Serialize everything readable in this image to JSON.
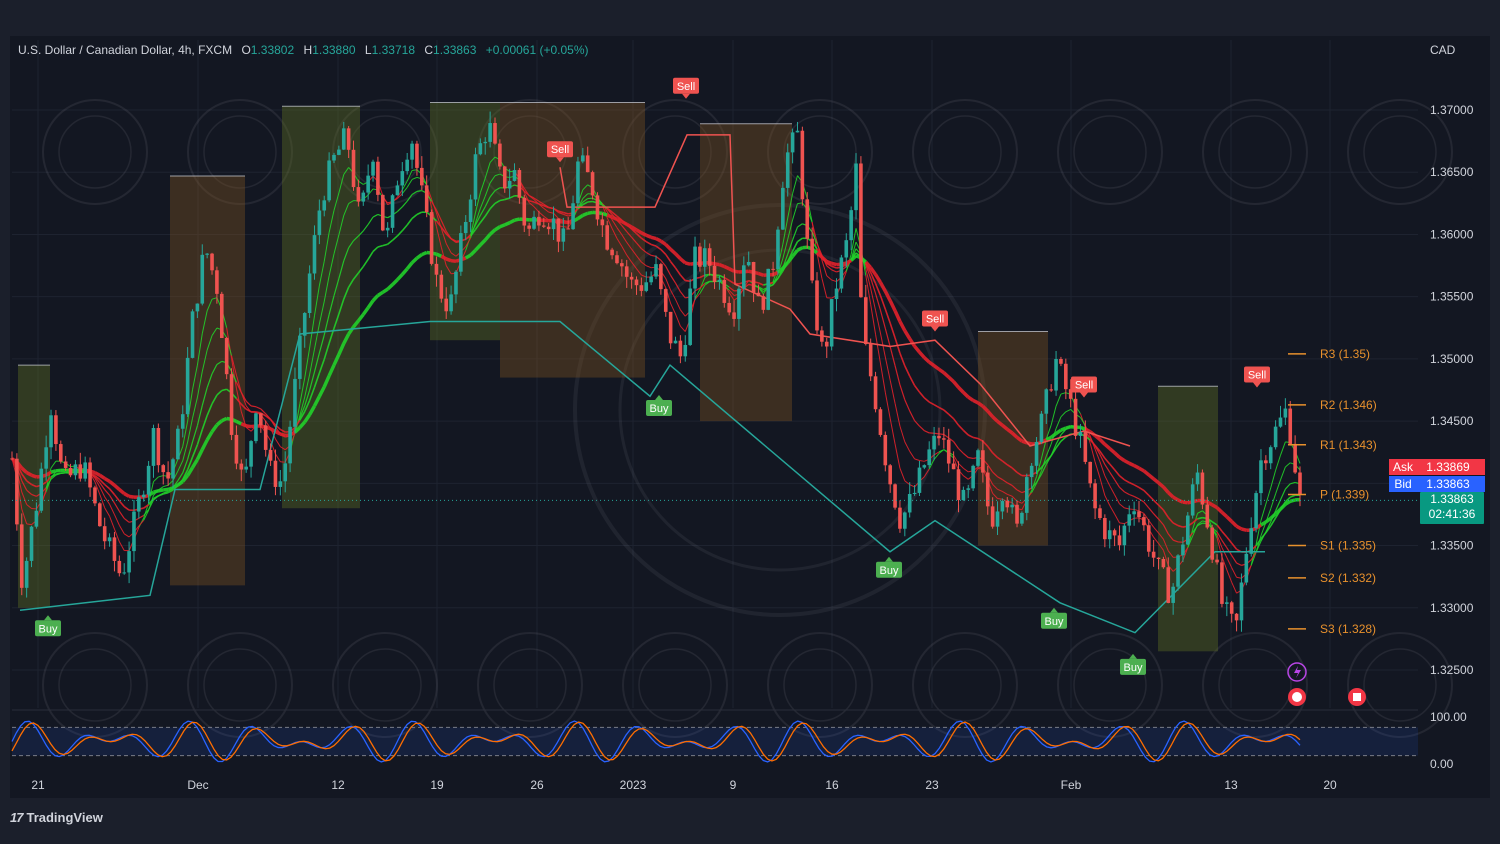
{
  "header": {
    "symbol": "U.S. Dollar / Canadian Dollar, 4h, FXCM",
    "open_label": "O",
    "open": "1.33802",
    "high_label": "H",
    "high": "1.33880",
    "low_label": "L",
    "low": "1.33718",
    "close_label": "C",
    "close": "1.33863",
    "change": "+0.00061 (+0.05%)"
  },
  "currency": "CAD",
  "quote": {
    "ask_label": "Ask",
    "ask": "1.33869",
    "bid_label": "Bid",
    "bid": "1.33863",
    "last_price": "1.33863",
    "countdown": "02:41:36"
  },
  "brand": {
    "name": "TradingView"
  },
  "colors": {
    "background": "#131722",
    "bull": "#26a69a",
    "bear": "#ef5350",
    "ema_green": "#22d12a",
    "ema_red": "#e3222b",
    "pivot": "#e8912d",
    "ask": "#f23645",
    "bid": "#2962ff"
  },
  "chart_data": {
    "type": "candlestick",
    "timeframe": "4h",
    "ylim": [
      1.322,
      1.3745
    ],
    "y_ticks": [
      "1.37000",
      "1.36500",
      "1.36000",
      "1.35500",
      "1.35000",
      "1.34500",
      "1.34000",
      "1.33500",
      "1.33000",
      "1.32500"
    ],
    "x_ticks": [
      "21",
      "Dec",
      "12",
      "19",
      "26",
      "2023",
      "9",
      "16",
      "23",
      "Feb",
      "13",
      "20"
    ],
    "close_path": [
      [
        0,
        1.342
      ],
      [
        0.008,
        1.332
      ],
      [
        0.02,
        1.339
      ],
      [
        0.03,
        1.3465
      ],
      [
        0.04,
        1.34
      ],
      [
        0.055,
        1.3415
      ],
      [
        0.07,
        1.336
      ],
      [
        0.085,
        1.3325
      ],
      [
        0.1,
        1.339
      ],
      [
        0.11,
        1.344
      ],
      [
        0.12,
        1.34
      ],
      [
        0.13,
        1.344
      ],
      [
        0.14,
        1.353
      ],
      [
        0.15,
        1.359
      ],
      [
        0.16,
        1.3555
      ],
      [
        0.17,
        1.345
      ],
      [
        0.18,
        1.3395
      ],
      [
        0.19,
        1.347
      ],
      [
        0.2,
        1.341
      ],
      [
        0.21,
        1.34
      ],
      [
        0.22,
        1.348
      ],
      [
        0.23,
        1.356
      ],
      [
        0.24,
        1.363
      ],
      [
        0.25,
        1.366
      ],
      [
        0.26,
        1.368
      ],
      [
        0.27,
        1.361
      ],
      [
        0.28,
        1.367
      ],
      [
        0.29,
        1.359
      ],
      [
        0.3,
        1.365
      ],
      [
        0.31,
        1.368
      ],
      [
        0.32,
        1.362
      ],
      [
        0.33,
        1.356
      ],
      [
        0.34,
        1.354
      ],
      [
        0.35,
        1.36
      ],
      [
        0.36,
        1.366
      ],
      [
        0.37,
        1.369
      ],
      [
        0.38,
        1.364
      ],
      [
        0.39,
        1.365
      ],
      [
        0.4,
        1.36
      ],
      [
        0.41,
        1.362
      ],
      [
        0.42,
        1.361
      ],
      [
        0.43,
        1.359
      ],
      [
        0.44,
        1.366
      ],
      [
        0.45,
        1.364
      ],
      [
        0.46,
        1.36
      ],
      [
        0.47,
        1.3585
      ],
      [
        0.48,
        1.356
      ],
      [
        0.49,
        1.356
      ],
      [
        0.5,
        1.357
      ],
      [
        0.51,
        1.352
      ],
      [
        0.52,
        1.35
      ],
      [
        0.53,
        1.358
      ],
      [
        0.54,
        1.358
      ],
      [
        0.55,
        1.356
      ],
      [
        0.56,
        1.354
      ],
      [
        0.57,
        1.359
      ],
      [
        0.58,
        1.354
      ],
      [
        0.59,
        1.357
      ],
      [
        0.6,
        1.366
      ],
      [
        0.61,
        1.368
      ],
      [
        0.62,
        1.356
      ],
      [
        0.63,
        1.35
      ],
      [
        0.64,
        1.356
      ],
      [
        0.65,
        1.36
      ],
      [
        0.655,
        1.366
      ],
      [
        0.66,
        1.352
      ],
      [
        0.67,
        1.347
      ],
      [
        0.68,
        1.341
      ],
      [
        0.69,
        1.337
      ],
      [
        0.7,
        1.339
      ],
      [
        0.71,
        1.342
      ],
      [
        0.72,
        1.344
      ],
      [
        0.73,
        1.341
      ],
      [
        0.74,
        1.338
      ],
      [
        0.75,
        1.342
      ],
      [
        0.76,
        1.337
      ],
      [
        0.77,
        1.34
      ],
      [
        0.78,
        1.336
      ],
      [
        0.79,
        1.342
      ],
      [
        0.8,
        1.345
      ],
      [
        0.81,
        1.35
      ],
      [
        0.82,
        1.347
      ],
      [
        0.83,
        1.343
      ],
      [
        0.84,
        1.338
      ],
      [
        0.85,
        1.336
      ],
      [
        0.86,
        1.335
      ],
      [
        0.87,
        1.339
      ],
      [
        0.88,
        1.336
      ],
      [
        0.89,
        1.333
      ],
      [
        0.9,
        1.331
      ],
      [
        0.91,
        1.336
      ],
      [
        0.92,
        1.341
      ],
      [
        0.93,
        1.336
      ],
      [
        0.94,
        1.33
      ],
      [
        0.95,
        1.328
      ],
      [
        0.96,
        1.336
      ],
      [
        0.97,
        1.342
      ],
      [
        0.98,
        1.344
      ],
      [
        0.99,
        1.346
      ],
      [
        1.0,
        1.3386
      ]
    ],
    "markers": [
      {
        "label": "Buy",
        "x": "21",
        "price": 1.3298
      },
      {
        "label": "Sell",
        "x": "26",
        "price": 1.3654
      },
      {
        "label": "Sell",
        "x": "2023",
        "price": 1.3705
      },
      {
        "label": "Buy",
        "x": "2023",
        "price": 1.3475
      },
      {
        "label": "Sell",
        "x": "23",
        "price": 1.3518
      },
      {
        "label": "Buy",
        "x": "23",
        "price": 1.3345
      },
      {
        "label": "Sell",
        "x": "Feb",
        "price": 1.3465
      },
      {
        "label": "Buy",
        "x": "Feb",
        "price": 1.3304
      },
      {
        "label": "Buy",
        "x": "Feb",
        "price": 1.3267
      },
      {
        "label": "Sell",
        "x": "13",
        "price": 1.3473
      }
    ],
    "pivots": [
      {
        "label": "R3 (1.35)",
        "price": 1.3504
      },
      {
        "label": "R2 (1.346)",
        "price": 1.3463
      },
      {
        "label": "R1 (1.343)",
        "price": 1.3431
      },
      {
        "label": "P (1.339)",
        "price": 1.3391
      },
      {
        "label": "S1 (1.335)",
        "price": 1.335
      },
      {
        "label": "S2 (1.332)",
        "price": 1.3324
      },
      {
        "label": "S3 (1.328)",
        "price": 1.3283
      }
    ],
    "oscillator": {
      "y_ticks": [
        "100.00",
        "0.00"
      ],
      "levels": [
        80,
        20
      ]
    }
  }
}
